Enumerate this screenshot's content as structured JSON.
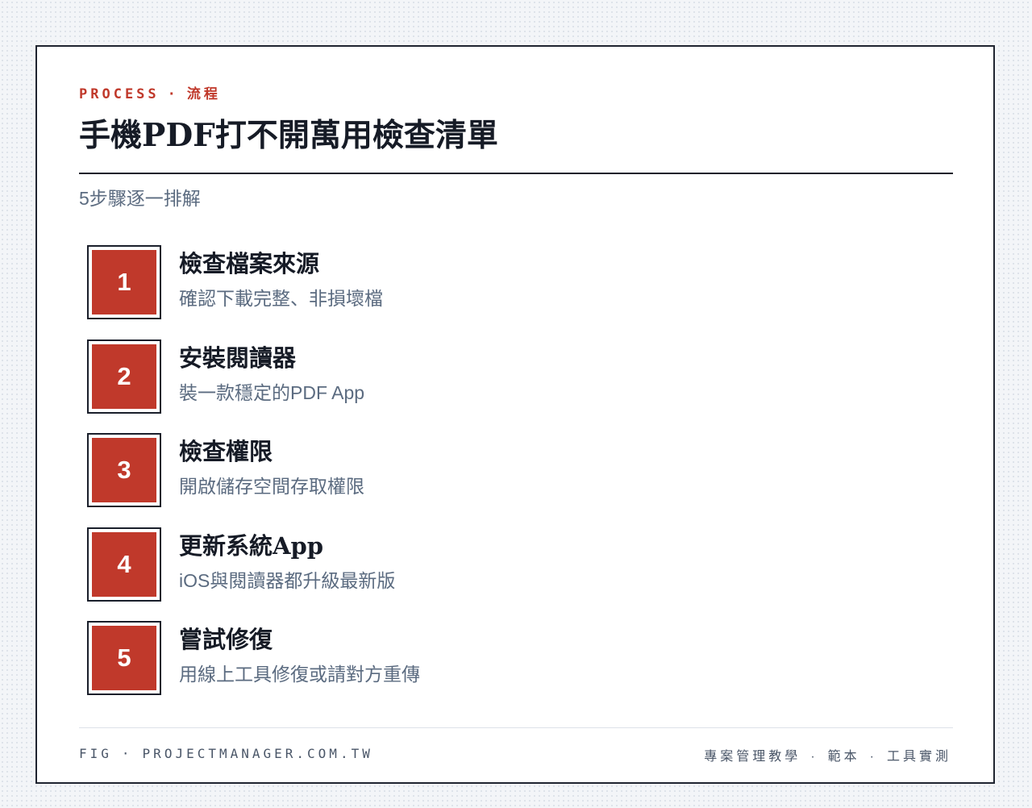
{
  "header": {
    "eyebrow_en": "PROCESS",
    "eyebrow_sep": "·",
    "eyebrow_zh": "流程",
    "title": "手機PDF打不開萬用檢查清單",
    "subtitle": "5步驟逐一排解"
  },
  "steps": [
    {
      "number": "1",
      "title": "檢查檔案來源",
      "description": "確認下載完整、非損壞檔"
    },
    {
      "number": "2",
      "title": "安裝閱讀器",
      "description": "裝一款穩定的PDF App"
    },
    {
      "number": "3",
      "title": "檢查權限",
      "description": "開啟儲存空間存取權限"
    },
    {
      "number": "4",
      "title": "更新系統App",
      "description": "iOS與閱讀器都升級最新版"
    },
    {
      "number": "5",
      "title": "嘗試修復",
      "description": "用線上工具修復或請對方重傳"
    }
  ],
  "footer": {
    "fig_label": "FIG",
    "separator": "·",
    "site": "PROJECTMANAGER.COM.TW",
    "tags": [
      "專案管理教學",
      "範本",
      "工具實測"
    ]
  },
  "colors": {
    "accent": "#c0392b",
    "ink": "#161b26",
    "muted": "#5b6b80"
  }
}
